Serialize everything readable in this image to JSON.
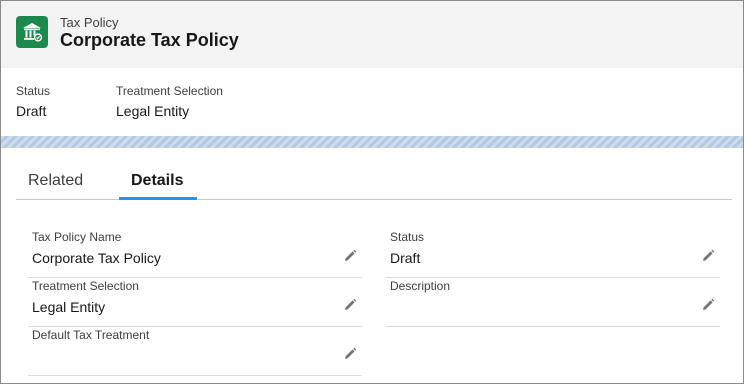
{
  "header": {
    "object_label": "Tax Policy",
    "record_title": "Corporate Tax Policy",
    "icon": "bank-building-icon",
    "icon_color": "#1d8a4d"
  },
  "highlights": [
    {
      "label": "Status",
      "value": "Draft"
    },
    {
      "label": "Treatment Selection",
      "value": "Legal Entity"
    }
  ],
  "tabs": [
    {
      "label": "Related",
      "active": false
    },
    {
      "label": "Details",
      "active": true
    }
  ],
  "details": {
    "tax_policy_name": {
      "label": "Tax Policy Name",
      "value": "Corporate Tax Policy"
    },
    "status": {
      "label": "Status",
      "value": "Draft"
    },
    "treatment_selection": {
      "label": "Treatment Selection",
      "value": "Legal Entity"
    },
    "description": {
      "label": "Description",
      "value": ""
    },
    "default_tax_treatment": {
      "label": "Default Tax Treatment",
      "value": ""
    }
  },
  "colors": {
    "accent": "#1b96ff",
    "band": "#b3c9e3",
    "edit_icon": "#747474"
  }
}
